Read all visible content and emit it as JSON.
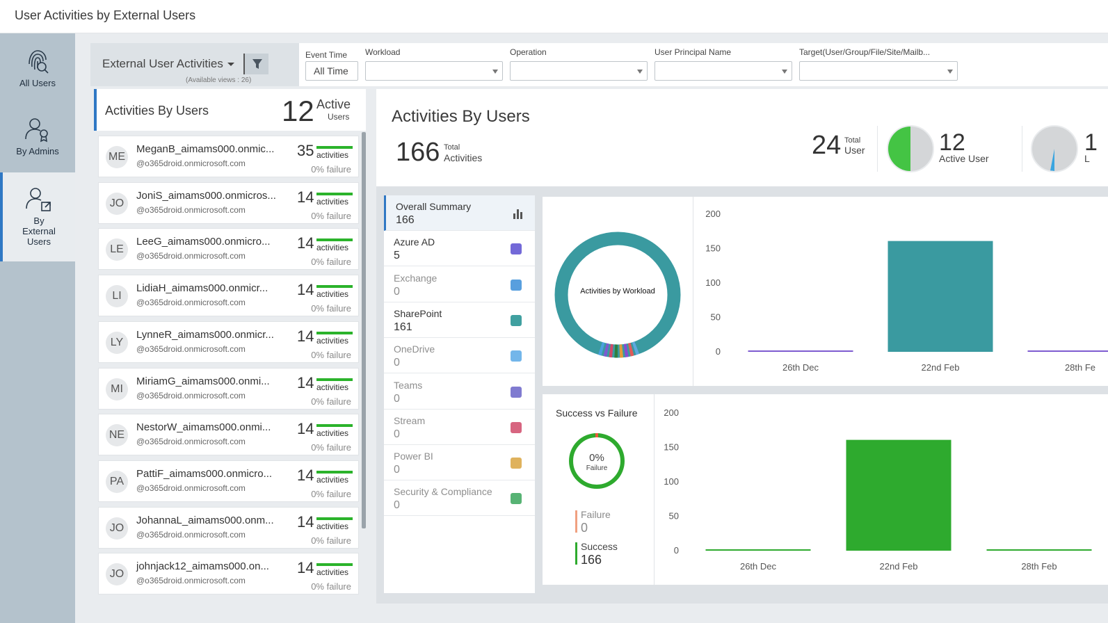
{
  "header": {
    "title": "User Activities by External Users"
  },
  "nav": {
    "all_users": "All Users",
    "by_admins": "By Admins",
    "by_external_line1": "By",
    "by_external_line2": "External",
    "by_external_line3": "Users"
  },
  "view": {
    "name": "External User Activities",
    "available": "(Available views : 26)"
  },
  "filters": {
    "event_time_label": "Event Time",
    "event_time_value": "All Time",
    "workload_label": "Workload",
    "operation_label": "Operation",
    "upn_label": "User Principal Name",
    "target_label": "Target(User/Group/File/Site/Mailb..."
  },
  "users_panel": {
    "title": "Activities By Users",
    "active_count": "12",
    "active_label1": "Active",
    "active_label2": "Users",
    "activities_word": "activities",
    "users": [
      {
        "initials": "ME",
        "name": "MeganB_aimams000.onmic...",
        "domain": "@o365droid.onmicrosoft.com",
        "count": "35",
        "failure": "0% failure"
      },
      {
        "initials": "JO",
        "name": "JoniS_aimams000.onmicros...",
        "domain": "@o365droid.onmicrosoft.com",
        "count": "14",
        "failure": "0% failure"
      },
      {
        "initials": "LE",
        "name": "LeeG_aimams000.onmicro...",
        "domain": "@o365droid.onmicrosoft.com",
        "count": "14",
        "failure": "0% failure"
      },
      {
        "initials": "LI",
        "name": "LidiaH_aimams000.onmicr...",
        "domain": "@o365droid.onmicrosoft.com",
        "count": "14",
        "failure": "0% failure"
      },
      {
        "initials": "LY",
        "name": "LynneR_aimams000.onmicr...",
        "domain": "@o365droid.onmicrosoft.com",
        "count": "14",
        "failure": "0% failure"
      },
      {
        "initials": "MI",
        "name": "MiriamG_aimams000.onmi...",
        "domain": "@o365droid.onmicrosoft.com",
        "count": "14",
        "failure": "0% failure"
      },
      {
        "initials": "NE",
        "name": "NestorW_aimams000.onmi...",
        "domain": "@o365droid.onmicrosoft.com",
        "count": "14",
        "failure": "0% failure"
      },
      {
        "initials": "PA",
        "name": "PattiF_aimams000.onmicro...",
        "domain": "@o365droid.onmicrosoft.com",
        "count": "14",
        "failure": "0% failure"
      },
      {
        "initials": "JO",
        "name": "JohannaL_aimams000.onm...",
        "domain": "@o365droid.onmicrosoft.com",
        "count": "14",
        "failure": "0% failure"
      },
      {
        "initials": "JO",
        "name": "johnjack12_aimams000.on...",
        "domain": "@o365droid.onmicrosoft.com",
        "count": "14",
        "failure": "0% failure"
      }
    ]
  },
  "summary": {
    "title": "Activities By Users",
    "total_activities": "166",
    "total_activities_l1": "Total",
    "total_activities_l2": "Activities",
    "total_users": "24",
    "total_users_l1": "Total",
    "total_users_l2": "User",
    "active_users": "12",
    "active_users_label": "Active User",
    "active_pie_fraction": 0.5,
    "third_partial_num": "1",
    "third_partial_label": "L",
    "third_pie_fraction": 0.03
  },
  "workloads": [
    {
      "name": "Overall Summary",
      "count": "166",
      "icon": "bar-chart-icon",
      "state": "active",
      "color": "#555"
    },
    {
      "name": "Azure AD",
      "count": "5",
      "icon": "azure-ad-icon",
      "state": "dark",
      "color": "#5b4fd1"
    },
    {
      "name": "Exchange",
      "count": "0",
      "icon": "exchange-icon",
      "state": "dim",
      "color": "#3b8ed8"
    },
    {
      "name": "SharePoint",
      "count": "161",
      "icon": "sharepoint-icon",
      "state": "dark",
      "color": "#1f8f8f"
    },
    {
      "name": "OneDrive",
      "count": "0",
      "icon": "onedrive-icon",
      "state": "dim",
      "color": "#5aa9e6"
    },
    {
      "name": "Teams",
      "count": "0",
      "icon": "teams-icon",
      "state": "dim",
      "color": "#6a64c8"
    },
    {
      "name": "Stream",
      "count": "0",
      "icon": "stream-icon",
      "state": "dim",
      "color": "#d04a6a"
    },
    {
      "name": "Power BI",
      "count": "0",
      "icon": "powerbi-icon",
      "state": "dim",
      "color": "#d9a441"
    },
    {
      "name": "Security & Compliance",
      "count": "0",
      "icon": "shield-icon",
      "state": "dim",
      "color": "#3aa65c"
    }
  ],
  "donut": {
    "center_label": "Activities by Workload",
    "main_color": "#3a9aa0",
    "segments": [
      {
        "color": "#5fa8e0"
      },
      {
        "color": "#e05a5a"
      },
      {
        "color": "#8a4bd1"
      },
      {
        "color": "#e39a3a"
      },
      {
        "color": "#2f7f3f"
      },
      {
        "color": "#d04a6a"
      },
      {
        "color": "#7d5bd0"
      },
      {
        "color": "#4aa0e0"
      }
    ]
  },
  "success_failure": {
    "title": "Success vs Failure",
    "pct": "0%",
    "pct_label": "Failure",
    "failure_label": "Failure",
    "failure_value": "0",
    "success_label": "Success",
    "success_value": "166",
    "success_color": "#2eaa2e",
    "failure_color": "#f0a080"
  },
  "chart_data": [
    {
      "type": "bar",
      "categories": [
        "26th Dec",
        "22nd Feb",
        "28th Fe"
      ],
      "values": [
        1,
        161,
        2
      ],
      "ylim": [
        0,
        200
      ],
      "yticks": [
        "200",
        "150",
        "100",
        "50",
        "0"
      ],
      "colors": [
        "#7d5bd0",
        "#3a9aa0",
        "#7d5bd0"
      ],
      "grid": false
    },
    {
      "type": "bar",
      "categories": [
        "26th Dec",
        "22nd Feb",
        "28th Feb"
      ],
      "values": [
        2,
        161,
        2
      ],
      "ylim": [
        0,
        200
      ],
      "yticks": [
        "200",
        "150",
        "100",
        "50",
        "0"
      ],
      "colors": [
        "#2eaa2e",
        "#2eaa2e",
        "#2eaa2e"
      ],
      "grid": false
    }
  ]
}
